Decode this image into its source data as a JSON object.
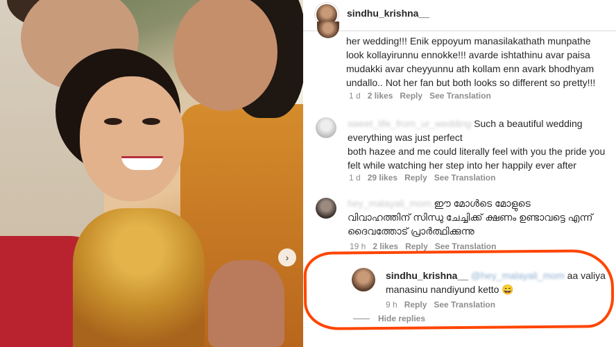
{
  "post_header": {
    "username": "sindhu_krishna__"
  },
  "photo": {
    "next_icon": "›"
  },
  "comments": [
    {
      "text": "her wedding!!! Enik eppoyum manasilakathath munpathe look kollayirunnu ennokke!!! avarde ishtathinu avar paisa mudakki avar cheyyunnu ath kollam enn avark bhodhyam undallo.. Not her fan but both looks so different so pretty!!!",
      "time": "1 d",
      "likes": "2 likes",
      "reply": "Reply",
      "translate": "See Translation"
    },
    {
      "username_blurred": "sweet_life_from_ur_wedding",
      "text_lead": "Such a beautiful wedding",
      "text": "everything was just perfect\nboth hazee and me could literally feel with you the pride you felt while watching her step into her happily ever after",
      "time": "1 d",
      "likes": "29 likes",
      "reply": "Reply",
      "translate": "See Translation"
    },
    {
      "username_blurred": "hey_malayali_mom",
      "text_lead": "ഈ മോൾടെ മോളുടെ",
      "text": "വിവാഹത്തിന് സിന്ധു ചേച്ചിക്ക് ക്ഷണം ഉണ്ടാവട്ടെ എന്ന് ദൈവത്തോട് പ്രാർത്ഥിക്കുന്നു",
      "time": "19 h",
      "likes": "2 likes",
      "reply": "Reply",
      "translate": "See Translation"
    },
    {
      "username": "sindhu_krishna__",
      "mention_blurred": "@hey_malayali_mom",
      "text": "aa valiya manasinu nandiyund ketto 😄",
      "time": "9 h",
      "reply": "Reply",
      "translate": "See Translation"
    }
  ],
  "hide_replies": "Hide replies",
  "colors": {
    "annotation": "#ff4500",
    "meta_gray": "#8e8e8e",
    "mention_blue": "#00376b"
  }
}
